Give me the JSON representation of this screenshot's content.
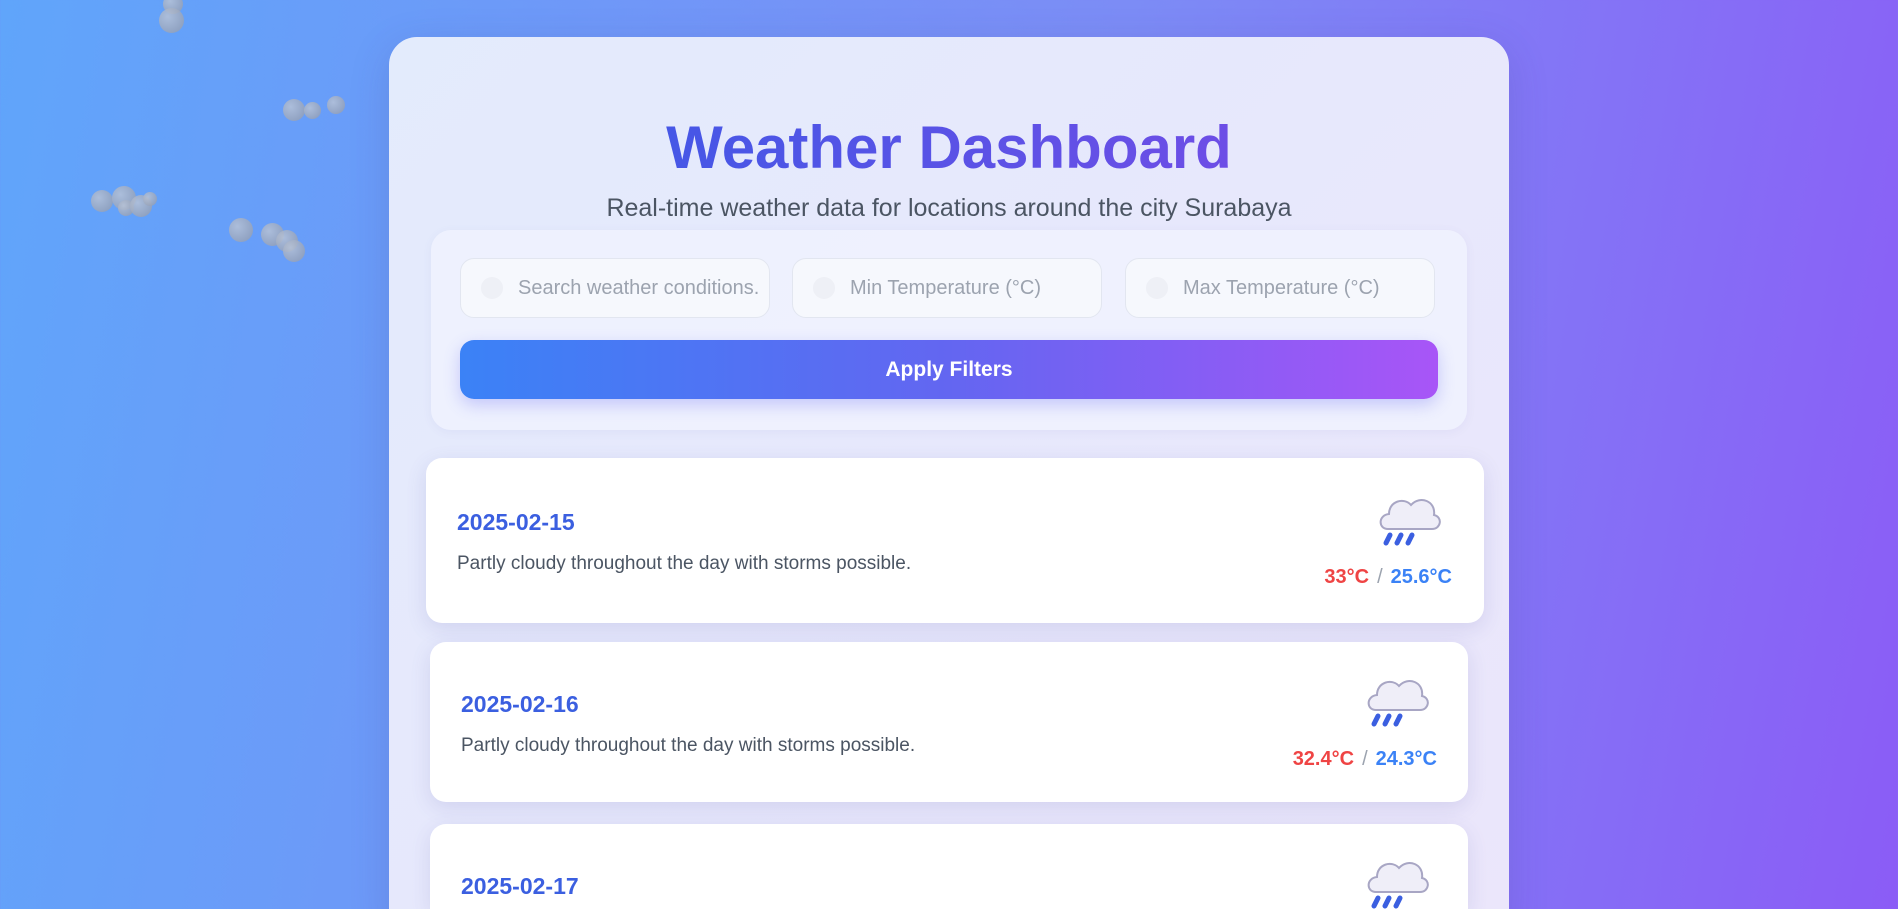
{
  "header": {
    "title": "Weather Dashboard",
    "subtitle": "Real-time weather data for locations around the city Surabaya"
  },
  "filters": {
    "search_placeholder": "Search weather conditions...",
    "min_temp_placeholder": "Min Temperature (°C)",
    "max_temp_placeholder": "Max Temperature (°C)",
    "apply_label": "Apply Filters"
  },
  "forecasts": [
    {
      "date": "2025-02-15",
      "description": "Partly cloudy throughout the day with storms possible.",
      "temp_max": "33°C",
      "temp_min": "25.6°C",
      "icon": "rain-cloud-icon"
    },
    {
      "date": "2025-02-16",
      "description": "Partly cloudy throughout the day with storms possible.",
      "temp_max": "32.4°C",
      "temp_min": "24.3°C",
      "icon": "rain-cloud-icon"
    },
    {
      "date": "2025-02-17",
      "icon": "rain-cloud-icon"
    }
  ],
  "temp_separator": "/",
  "colors": {
    "accent_blue": "#3b5fe0",
    "temp_high": "#ef4444",
    "temp_low": "#3b82f6",
    "button_gradient_start": "#3b82f6",
    "button_gradient_end": "#a855f7"
  }
}
